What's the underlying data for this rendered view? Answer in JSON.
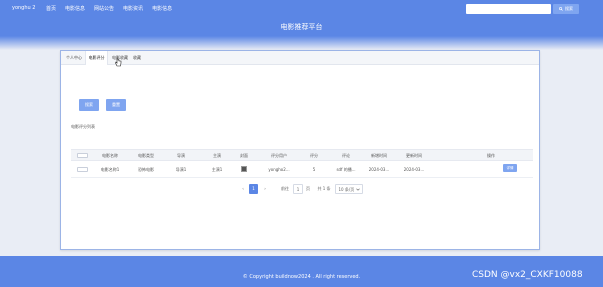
{
  "topbar": {
    "user": "yonghu 2",
    "nav": [
      "首页",
      "电影信息",
      "网站公告",
      "电影资讯",
      "电影信息"
    ],
    "search_button": "搜索"
  },
  "banner": {
    "title": "电影推荐平台"
  },
  "tabs": [
    {
      "label": "个人中心"
    },
    {
      "label": "电影评分"
    },
    {
      "label": "电影收藏"
    },
    {
      "label": "收藏"
    }
  ],
  "toolbar": {
    "search_label": "搜索",
    "reset_label": "重置"
  },
  "list": {
    "title": "电影评分列表"
  },
  "table": {
    "headers": [
      "电影名称",
      "电影类型",
      "导演",
      "主演",
      "封面",
      "评分用户",
      "评分",
      "评论",
      "新增时间",
      "更新时间",
      "操作"
    ],
    "rows": [
      [
        "电影名称1",
        "恐怖电影",
        "导演1",
        "主演1",
        "",
        "yongho2...",
        "5",
        "sdf 的播...",
        "2024-03...",
        "2024-03...",
        "详情"
      ]
    ]
  },
  "pager": {
    "total": "共 1 条",
    "page": "1",
    "goto_label": "前往",
    "goto_value": "1",
    "page_unit": "页",
    "page_size": "10 条/页"
  },
  "footer": {
    "copyright": "© Copyright buildnow2024 . All right reserved.",
    "watermark": "CSDN @vx2_CXKF10088"
  }
}
